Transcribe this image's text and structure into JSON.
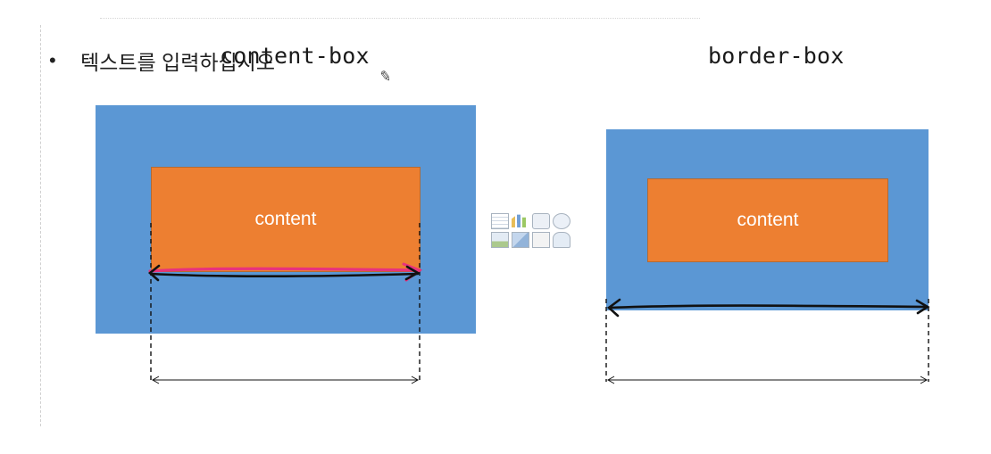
{
  "slide": {
    "bullet": "•",
    "placeholder": "텍스트를 입력하십시오"
  },
  "diagrams": [
    {
      "label": "content-box",
      "inner_label": "content"
    },
    {
      "label": "border-box",
      "inner_label": "content"
    }
  ],
  "colors": {
    "outer_box": "#5b97d4",
    "inner_box": "#ed7f31",
    "pen_pink": "#e8327c",
    "pen_black": "#111111"
  },
  "toolbar_icons": [
    "table-icon",
    "chart-icon",
    "smartart-icon",
    "3d-model-icon",
    "picture-icon",
    "online-picture-icon",
    "video-icon",
    "icons-icon"
  ]
}
